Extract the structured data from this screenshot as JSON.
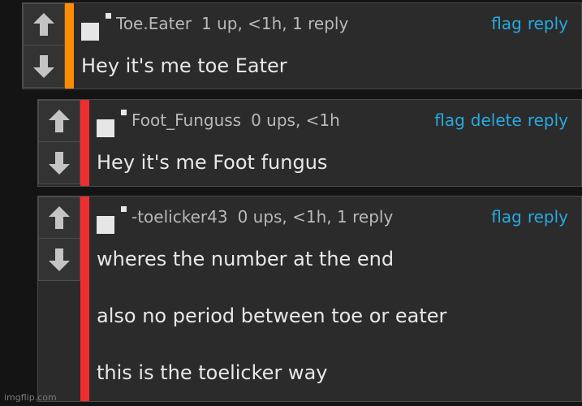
{
  "comments": [
    {
      "username": "Toe.Eater",
      "meta": "1 up, <1h, 1 reply",
      "actions": [
        "flag",
        "reply"
      ],
      "lines": [
        "Hey it's me toe Eater"
      ],
      "bar_color": "#ff8c00"
    },
    {
      "username": "Foot_Funguss",
      "meta": "0 ups, <1h",
      "actions": [
        "flag",
        "delete",
        "reply"
      ],
      "lines": [
        "Hey it's me Foot fungus"
      ],
      "bar_color": "#ee2e2e"
    },
    {
      "username": "-toelicker43",
      "meta": "0 ups, <1h, 1 reply",
      "actions": [
        "flag",
        "reply"
      ],
      "lines": [
        "wheres the number at the end",
        "also no period between toe or eater",
        "this is the toelicker way"
      ],
      "bar_color": "#ee2e2e"
    }
  ],
  "icons": {
    "upvote": "arrow-up-icon",
    "downvote": "arrow-down-icon"
  },
  "colors": {
    "link": "#27a9e0",
    "background": "#141414",
    "card": "#2b2b2b"
  },
  "watermark": "imgflip.com"
}
